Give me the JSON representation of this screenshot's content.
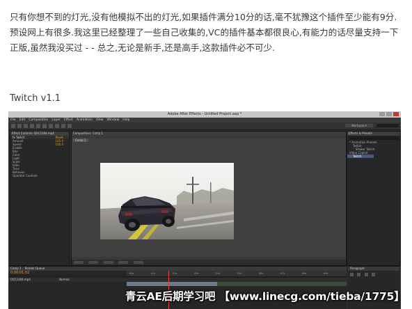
{
  "article": {
    "paragraph": "只有你想不到的灯光,没有他模拟不出的灯光,如果插件满分10分的话,毫不犹豫这个插件至少能有9分.预设网上有很多.我这里已经整理了一些自己收集的,VC的插件基本都很良心,有能力的话尽量支持一下正版,虽然我没买过 - - 总之,无论是新手,还是高手,这款插件必不可少."
  },
  "section": {
    "title": "Twitch v1.1"
  },
  "screenshot": {
    "window_title": "Adobe After Effects - Untitled Project.aep *",
    "menu": [
      "File",
      "Edit",
      "Composition",
      "Layer",
      "Effect",
      "Animation",
      "View",
      "Window",
      "Help"
    ],
    "workspace_label": "Workspace",
    "effects_tab": "Effect Controls: DSC2284.mp4",
    "effects_rows": [
      {
        "label": "fx Twitch",
        "value": "Reset"
      },
      {
        "label": "Amount",
        "value": "100.0"
      },
      {
        "label": "Speed",
        "value": "100.0"
      },
      {
        "label": "Enable",
        "value": ""
      },
      {
        "label": "Blur",
        "value": ""
      },
      {
        "label": "Color",
        "value": ""
      },
      {
        "label": "Light",
        "value": ""
      },
      {
        "label": "Scale",
        "value": ""
      },
      {
        "label": "Slide",
        "value": ""
      },
      {
        "label": "Time",
        "value": ""
      },
      {
        "label": "Behavior",
        "value": ""
      },
      {
        "label": "Operator Controls",
        "value": ""
      }
    ],
    "comp_tab": "Composition: Comp 1",
    "comp_sub_tab": "Comp 1",
    "right_tab": "Effects & Presets",
    "right_rows": [
      {
        "label": "* Animation Presets",
        "highlight": false
      },
      {
        "label": "Twitch",
        "highlight": false
      },
      {
        "label": "Shaker Twitch",
        "highlight": false
      },
      {
        "label": "Video Copilot",
        "highlight": false
      },
      {
        "label": "Twitch",
        "highlight": true
      }
    ],
    "timeline_tab": "Comp 1",
    "render_queue_tab": "Render Queue",
    "timecode": "0;00;01;02",
    "layer_name": "DSC2284.mp4",
    "layer_mode": "Normal",
    "ruler_ticks": [
      "00s",
      "01s",
      "02s",
      "03s",
      "04s",
      "05s",
      "06s",
      "07s",
      "08s",
      "09s"
    ],
    "paragraph_tab": "Paragraph",
    "watermark": "青云AE后期学习吧 【www.linecg.com/tieba/1775】"
  }
}
